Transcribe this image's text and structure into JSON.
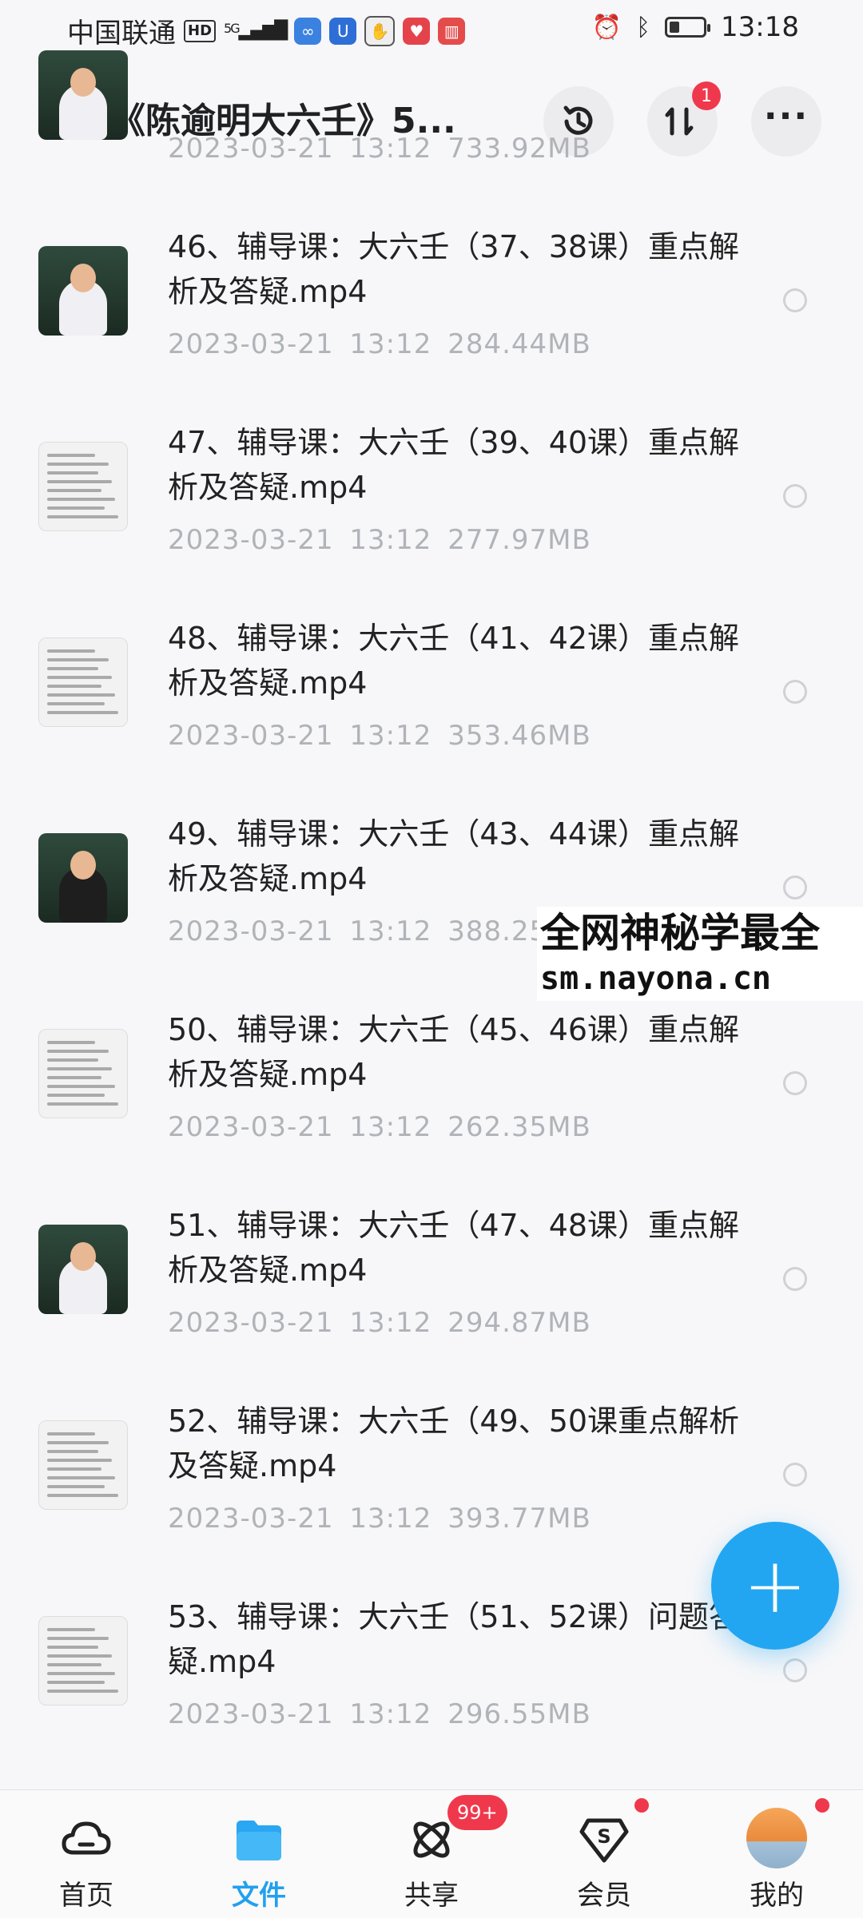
{
  "status_bar": {
    "carrier": "中国联通",
    "network_badge": "HD",
    "signal": "5G",
    "time": "13:18",
    "battery_level": 0.3
  },
  "header": {
    "back_icon": "chevron-left-icon",
    "title": "《陈逾明大六壬》5...",
    "transfer_badge": "1"
  },
  "files": [
    {
      "name": "",
      "meta": "2023-03-21  13:12  733.92MB",
      "thumb": "video"
    },
    {
      "name": "46、辅导课：大六壬（37、38课）重点解析及答疑.mp4",
      "meta": "2023-03-21  13:12  284.44MB",
      "thumb": "video"
    },
    {
      "name": "47、辅导课：大六壬（39、40课）重点解析及答疑.mp4",
      "meta": "2023-03-21  13:12  277.97MB",
      "thumb": "doc"
    },
    {
      "name": "48、辅导课：大六壬（41、42课）重点解析及答疑.mp4",
      "meta": "2023-03-21  13:12  353.46MB",
      "thumb": "doc"
    },
    {
      "name": "49、辅导课：大六壬（43、44课）重点解析及答疑.mp4",
      "meta": "2023-03-21  13:12  388.25MB",
      "thumb": "video"
    },
    {
      "name": "50、辅导课：大六壬（45、46课）重点解析及答疑.mp4",
      "meta": "2023-03-21  13:12  262.35MB",
      "thumb": "doc"
    },
    {
      "name": "51、辅导课：大六壬（47、48课）重点解析及答疑.mp4",
      "meta": "2023-03-21  13:12  294.87MB",
      "thumb": "video"
    },
    {
      "name": "52、辅导课：大六壬（49、50课重点解析及答疑.mp4",
      "meta": "2023-03-21  13:12  393.77MB",
      "thumb": "doc"
    },
    {
      "name": "53、辅导课：大六壬（51、52课）问题答疑.mp4",
      "meta": "2023-03-21  13:12  296.55MB",
      "thumb": "doc"
    }
  ],
  "watermark": {
    "line1": "全网神秘学最全",
    "line2": "sm.nayona.cn"
  },
  "tabs": [
    {
      "label": "首页",
      "icon": "cloud-icon",
      "active": false
    },
    {
      "label": "文件",
      "icon": "folder-icon",
      "active": true
    },
    {
      "label": "共享",
      "icon": "atom-icon",
      "active": false,
      "badge": "99+"
    },
    {
      "label": "会员",
      "icon": "diamond-s-icon",
      "active": false
    },
    {
      "label": "我的",
      "icon": "avatar-icon",
      "active": false
    }
  ],
  "colors": {
    "accent": "#22a6f2",
    "badge_red": "#f0384c",
    "meta_gray": "#b0b3b8"
  }
}
